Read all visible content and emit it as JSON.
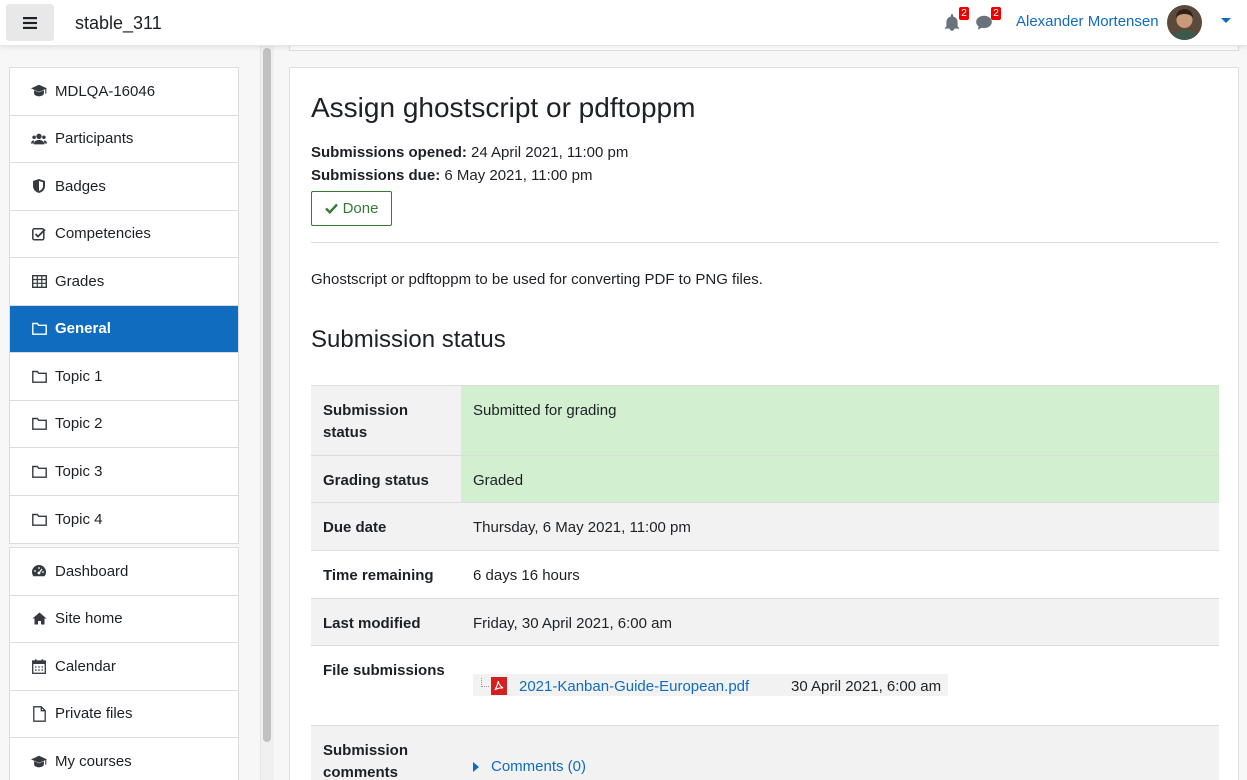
{
  "navbar": {
    "site_name": "stable_311",
    "notifications_count": "2",
    "messages_count": "2",
    "user_name": "Alexander Mortensen"
  },
  "sidebar": {
    "course_items": [
      {
        "label": "MDLQA-16046",
        "icon": "graduation-cap-icon"
      },
      {
        "label": "Participants",
        "icon": "users-icon"
      },
      {
        "label": "Badges",
        "icon": "shield-icon"
      },
      {
        "label": "Competencies",
        "icon": "check-square-icon"
      },
      {
        "label": "Grades",
        "icon": "table-icon"
      },
      {
        "label": "General",
        "icon": "folder-icon",
        "active": true
      },
      {
        "label": "Topic 1",
        "icon": "folder-icon"
      },
      {
        "label": "Topic 2",
        "icon": "folder-icon"
      },
      {
        "label": "Topic 3",
        "icon": "folder-icon"
      },
      {
        "label": "Topic 4",
        "icon": "folder-icon"
      }
    ],
    "site_items": [
      {
        "label": "Dashboard",
        "icon": "dashboard-icon"
      },
      {
        "label": "Site home",
        "icon": "home-icon"
      },
      {
        "label": "Calendar",
        "icon": "calendar-icon"
      },
      {
        "label": "Private files",
        "icon": "file-icon"
      },
      {
        "label": "My courses",
        "icon": "graduation-cap-icon"
      }
    ]
  },
  "assignment": {
    "title": "Assign ghostscript or pdftoppm",
    "opened_label": "Submissions opened:",
    "opened_value": "24 April 2021, 11:00 pm",
    "due_label": "Submissions due:",
    "due_value": "6 May 2021, 11:00 pm",
    "done_label": "Done",
    "intro": "Ghostscript or pdftoppm to be used for converting PDF to PNG files."
  },
  "submission": {
    "section_title": "Submission status",
    "rows": {
      "status": {
        "label": "Submission status",
        "value": "Submitted for grading"
      },
      "grading": {
        "label": "Grading status",
        "value": "Graded"
      },
      "due": {
        "label": "Due date",
        "value": "Thursday, 6 May 2021, 11:00 pm"
      },
      "remaining": {
        "label": "Time remaining",
        "value": "6 days 16 hours"
      },
      "modified": {
        "label": "Last modified",
        "value": "Friday, 30 April 2021, 6:00 am"
      },
      "files": {
        "label": "File submissions",
        "file_name": "2021-Kanban-Guide-European.pdf",
        "file_date": "30 April 2021, 6:00 am"
      },
      "comments": {
        "label": "Submission comments",
        "link": "Comments (0)"
      }
    }
  },
  "colors": {
    "accent": "#0f6cbf",
    "success": "#357a32",
    "green_bg": "#d2efd0",
    "badge": "#e00000"
  }
}
